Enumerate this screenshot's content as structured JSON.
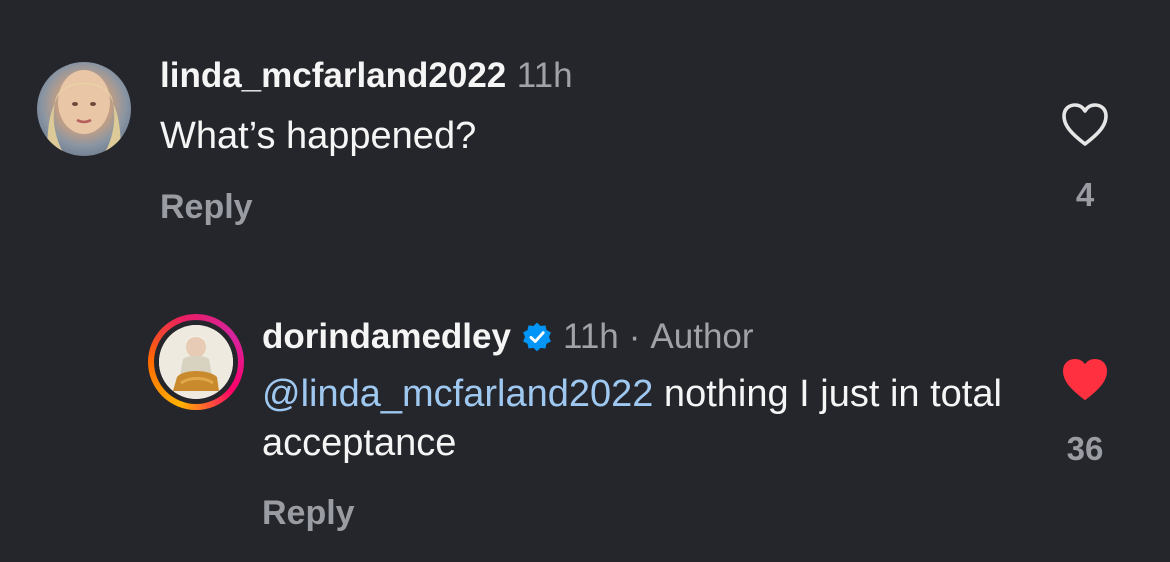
{
  "comments": [
    {
      "username": "linda_mcfarland2022",
      "time": "11h",
      "text": "What’s happened?",
      "reply_label": "Reply",
      "like_count": "4",
      "liked": false
    },
    {
      "username": "dorindamedley",
      "verified": true,
      "time": "11h",
      "separator": "·",
      "author_tag": "Author",
      "mention": "@linda_mcfarland2022",
      "text_after_mention": " nothing I just in total acceptance",
      "reply_label": "Reply",
      "like_count": "36",
      "liked": true
    }
  ],
  "colors": {
    "background": "#25262b",
    "mention": "#9fc8f0",
    "liked_heart": "#ff3040",
    "verified_badge": "#0095f6",
    "muted_text": "#9a9ca3"
  },
  "icons": {
    "like_outline": "heart-outline-icon",
    "like_filled": "heart-filled-icon",
    "verified": "verified-badge-icon"
  }
}
